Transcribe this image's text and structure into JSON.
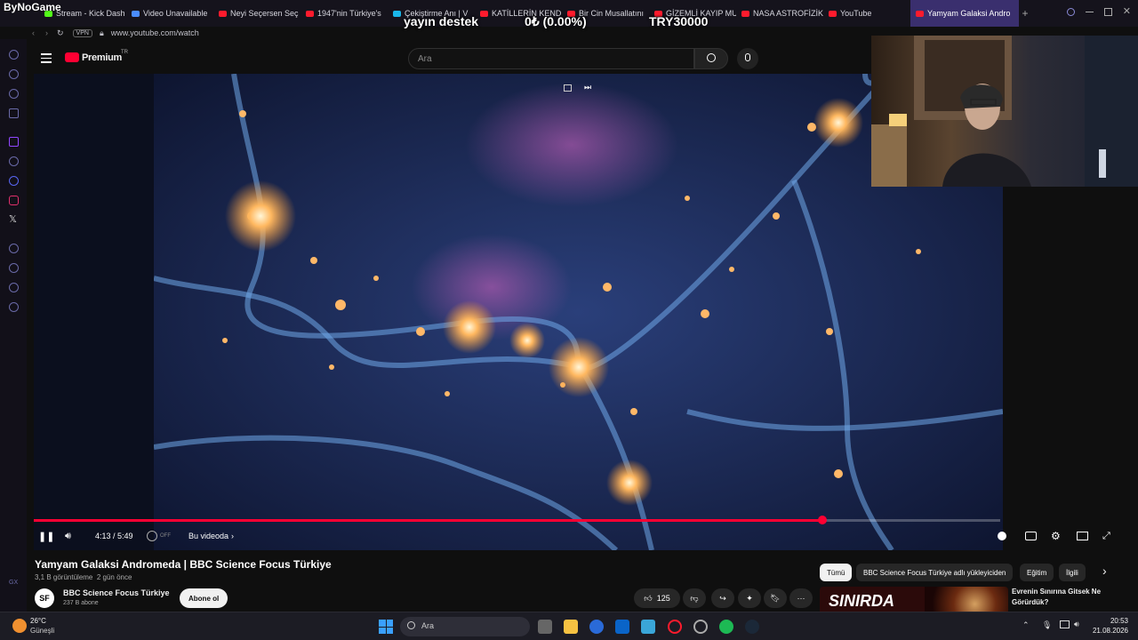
{
  "overlay": {
    "brand": "ByNoGame",
    "label": "yayın destek",
    "percent": "0₺ (0.00%)",
    "goal": "TRY30000"
  },
  "browser": {
    "tabs": [
      {
        "label": "Stream - Kick Dash"
      },
      {
        "label": "Video Unavailable"
      },
      {
        "label": "Neyi Seçersen Seç"
      },
      {
        "label": "1947'nin Türkiye's"
      },
      {
        "label": "Çekiştirme Anı | V"
      },
      {
        "label": "KATİLLERİN KENDİ"
      },
      {
        "label": "Bir Cin Musallatını"
      },
      {
        "label": "GİZEMLİ KAYIP MU"
      },
      {
        "label": "NASA ASTROFİZİK"
      },
      {
        "label": "YouTube"
      },
      {
        "label": "Yamyam Galaksi Andro"
      }
    ],
    "url": "www.youtube.com/watch",
    "vpn": "VPN"
  },
  "youtube": {
    "logo": "Premium",
    "region": "TR",
    "search_placeholder": "Ara"
  },
  "player": {
    "time": "4:13 / 5:49",
    "progress": 0.816,
    "in_video": "Bu videoda",
    "off": "OFF"
  },
  "video": {
    "title": "Yamyam Galaksi Andromeda | BBC Science Focus Türkiye",
    "views": "3,1 B görüntüleme",
    "age": "2 gün önce",
    "channel": "BBC Science Focus Türkiye",
    "channel_initials": "SF",
    "subs": "237 B abone",
    "subscribe": "Abone ol",
    "likes": "125"
  },
  "chips": [
    "Tümü",
    "BBC Science Focus Türkiye adlı yükleyiciden",
    "Eğitim",
    "İlgili"
  ],
  "related": {
    "thumb_text": "SINIRDA",
    "title": "Evrenin Sınırına Gitsek Ne Görürdük?"
  },
  "taskbar": {
    "temp": "26°C",
    "weather": "Güneşli",
    "search": "Ara",
    "time": "20:53",
    "date": "21.08.2026"
  }
}
